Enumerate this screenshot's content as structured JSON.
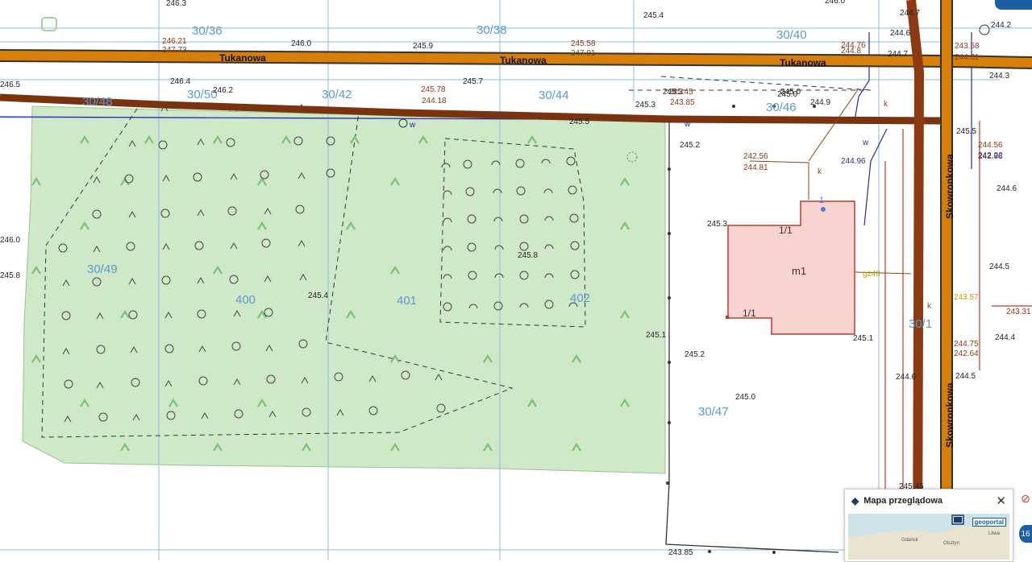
{
  "map": {
    "streets": {
      "tukanowa": "Tukanowa",
      "skowronkowa": "Skowronkowa"
    },
    "parcels": [
      "30/36",
      "30/38",
      "30/40",
      "30/48",
      "30/50",
      "30/42",
      "30/44",
      "30/46",
      "30/49",
      "400",
      "401",
      "402",
      "30/47",
      "30/1"
    ],
    "building": {
      "label": "m1",
      "storey_a": "1/1",
      "storey_b": "1/1",
      "entrance": "1"
    },
    "elevations": [
      "246.3",
      "245.4",
      "246.21",
      "247.73",
      "246.0",
      "245.9",
      "245.58",
      "247.91",
      "244.76",
      "244.8",
      "244.7",
      "244.6",
      "246.5",
      "246.4",
      "246.2",
      "245.7",
      "245.78",
      "244.18",
      "245.3",
      "245.45",
      "243.85",
      "245.0",
      "244.9",
      "245.5",
      "245.2",
      "244.96",
      "242.56",
      "244.81",
      "245.8",
      "245.1",
      "245.2",
      "245.0",
      "245.4",
      "244.2",
      "244.3",
      "244.4",
      "244.5",
      "243.57",
      "244.75",
      "242.64",
      "243.31",
      "242.96",
      "244.56",
      "242.22",
      "244.61",
      "243.58"
    ],
    "utility_markers": [
      "w",
      "w",
      "k",
      "k",
      "w",
      "k",
      "gz40"
    ],
    "colors": {
      "forest": "#cfe9c8",
      "road_main": "#d67f0a",
      "road_secondary": "#8b3a12",
      "parcel_line": "#8fbbe6",
      "building_fill": "#f8d3d0",
      "building_stroke": "#c0392b",
      "label": "#5b97d1"
    }
  },
  "overview": {
    "title": "Mapa przeglądowa",
    "logo": "geoportal",
    "close_icon": "close-icon",
    "map_labels": [
      "Gdańsk",
      "Olsztyn",
      "Litwa"
    ]
  },
  "side_buttons": {
    "zoom": "16"
  }
}
